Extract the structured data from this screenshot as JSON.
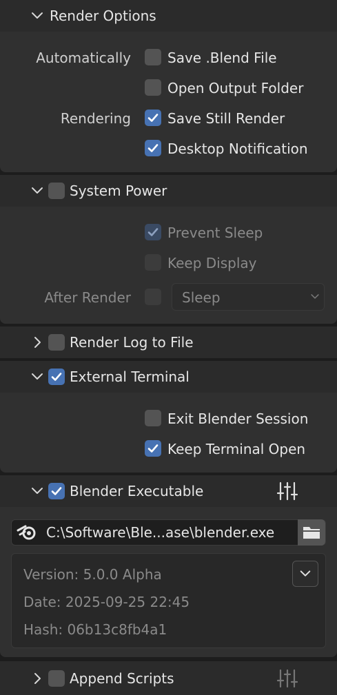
{
  "render_options": {
    "title": "Render Options",
    "automatically_label": "Automatically",
    "save_blend": "Save .Blend File",
    "open_output": "Open Output Folder",
    "rendering_label": "Rendering",
    "save_still": "Save Still Render",
    "desktop_notification": "Desktop Notification"
  },
  "system_power": {
    "title": "System Power",
    "prevent_sleep": "Prevent Sleep",
    "keep_display": "Keep Display",
    "after_render_label": "After Render",
    "after_render_value": "Sleep"
  },
  "render_log": {
    "title": "Render Log to File"
  },
  "external_terminal": {
    "title": "External Terminal",
    "exit_session": "Exit Blender Session",
    "keep_open": "Keep Terminal Open"
  },
  "blender_executable": {
    "title": "Blender Executable",
    "path": "C:\\Software\\Ble...ase\\blender.exe",
    "version": "Version: 5.0.0 Alpha",
    "date": "Date: 2025-09-25 22:45",
    "hash": "Hash: 06b13c8fb4a1"
  },
  "append_scripts": {
    "title": "Append Scripts"
  },
  "colors": {
    "accent": "#4772b3",
    "panel": "#303030",
    "header": "#2b2b2b"
  }
}
